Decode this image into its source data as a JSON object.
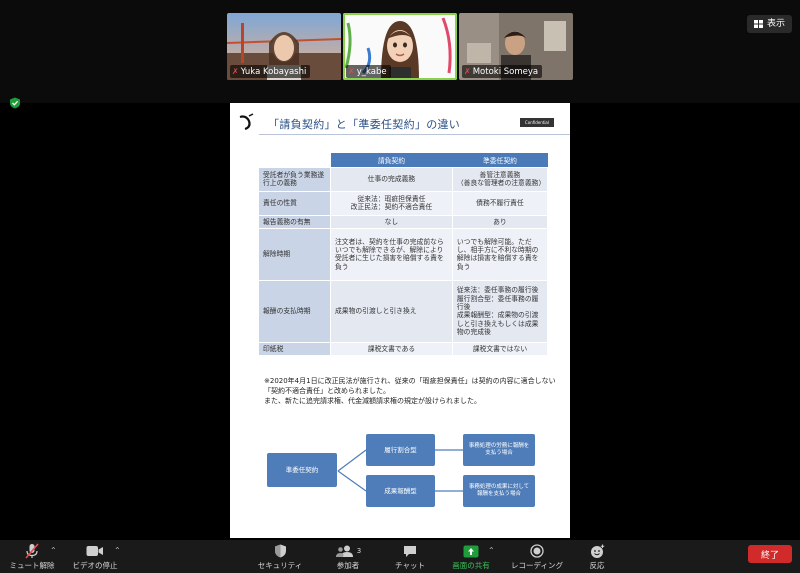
{
  "participants": [
    {
      "name": "Yuka Kobayashi",
      "muted": true
    },
    {
      "name": "y_kabe",
      "muted": true,
      "active": true
    },
    {
      "name": "Motoki Someya",
      "muted": true
    }
  ],
  "view_button": {
    "label": "表示"
  },
  "slide": {
    "title": "「請負契約」と「準委任契約」の違い",
    "badge": "Confidential",
    "table": {
      "headers": [
        "",
        "請負契約",
        "準委任契約"
      ],
      "rows": [
        [
          "受託者が負う業務遂行上の義務",
          "仕事の完成義務",
          "善管注意義務\n（善良な管理者の注意義務）"
        ],
        [
          "責任の性質",
          "従来法：瑕疵担保責任\n改正民法：契約不適合責任",
          "債務不履行責任"
        ],
        [
          "報告義務の有無",
          "なし",
          "あり"
        ],
        [
          "解除時期",
          "注文者は、契約を仕事の完成前ならいつでも解除できるが、解除により受託者に生じた損害を賠償する責を負う",
          "いつでも解除可能。ただし、相手方に不利な時期の解除は損害を賠償する責を負う"
        ],
        [
          "報酬の支払時期",
          "成果物の引渡しと引き換え",
          "従来法：委任事務の履行後\n履行割合型：委任事務の履行後\n成果報酬型：成果物の引渡しと引き換えもしくは成果物の完成後"
        ],
        [
          "印紙税",
          "課税文書である",
          "課税文書ではない"
        ]
      ]
    },
    "note": "※2020年4月1日に改正民法が施行され、従来の「瑕疵担保責任」は契約の内容に適合しない「契約不適合責任」と改められました。\nまた、新たに追完請求権、代金減額請求権の規定が設けられました。",
    "diagram": {
      "root": "準委任契約",
      "branches": [
        {
          "label": "履行割合型",
          "desc": "事務処理の労務に報酬を支払う場合"
        },
        {
          "label": "成果報酬型",
          "desc": "事務処理の成果に対して報酬を支払う場合"
        }
      ]
    }
  },
  "toolbar": {
    "mute": "ミュート解除",
    "video": "ビデオの停止",
    "security": "セキュリティ",
    "participants": "参加者",
    "participants_count": "3",
    "chat": "チャット",
    "share": "画面の共有",
    "record": "レコーディング",
    "reactions": "反応",
    "end": "終了"
  },
  "colors": {
    "accent_green": "#1f9d3a",
    "end_red": "#d12a2a",
    "slide_blue": "#4a7ab8"
  }
}
